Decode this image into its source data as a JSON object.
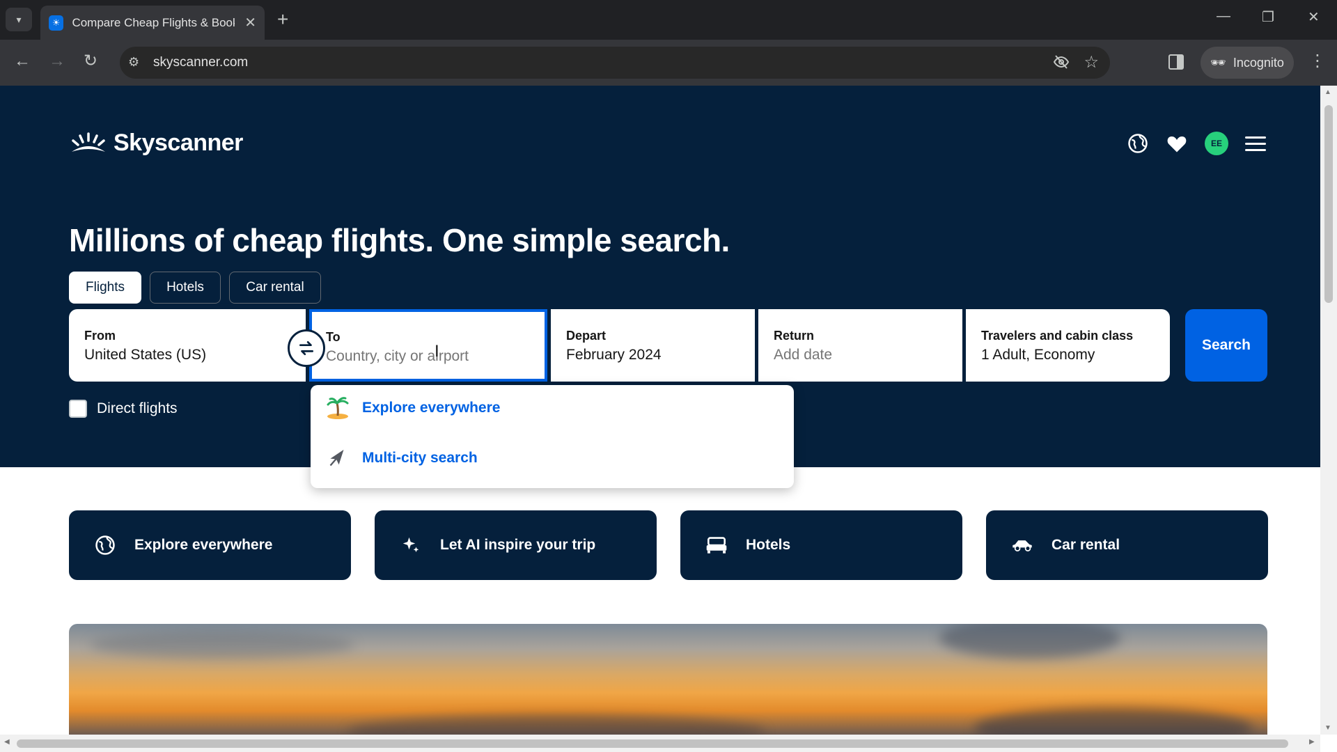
{
  "browser": {
    "tab_title": "Compare Cheap Flights & Book",
    "url": "skyscanner.com",
    "incognito_label": "Incognito"
  },
  "header": {
    "brand": "Skyscanner",
    "avatar_initials": "EE"
  },
  "hero": {
    "headline": "Millions of cheap flights. One simple search."
  },
  "tabs": [
    {
      "label": "Flights",
      "active": true
    },
    {
      "label": "Hotels",
      "active": false
    },
    {
      "label": "Car rental",
      "active": false
    }
  ],
  "search_form": {
    "from": {
      "label": "From",
      "value": "United States (US)"
    },
    "to": {
      "label": "To",
      "placeholder": "Country, city or airport"
    },
    "depart": {
      "label": "Depart",
      "value": "February 2024"
    },
    "return": {
      "label": "Return",
      "placeholder": "Add date"
    },
    "travelers": {
      "label": "Travelers and cabin class",
      "value": "1 Adult, Economy"
    },
    "search_label": "Search",
    "direct_flights_label": "Direct flights",
    "direct_flights_checked": false
  },
  "dropdown": {
    "items": [
      {
        "label": "Explore everywhere",
        "icon": "island-icon"
      },
      {
        "label": "Multi-city search",
        "icon": "plane-icon"
      }
    ]
  },
  "quick_links": [
    {
      "label": "Explore everywhere",
      "icon": "globe-icon"
    },
    {
      "label": "Let AI inspire your trip",
      "icon": "sparkle-icon"
    },
    {
      "label": "Hotels",
      "icon": "bed-icon"
    },
    {
      "label": "Car rental",
      "icon": "car-icon"
    }
  ],
  "colors": {
    "hero_bg": "#05203c",
    "accent": "#0062e3"
  }
}
